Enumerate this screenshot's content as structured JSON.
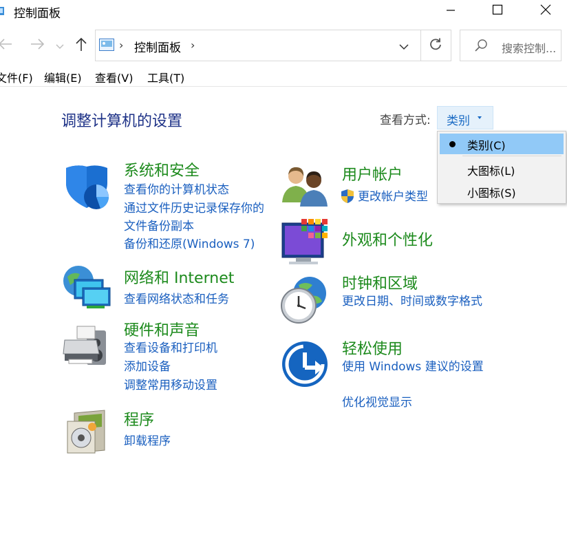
{
  "window": {
    "title": "控制面板",
    "icons": {
      "app": "control-panel-icon",
      "minimize": "minimize-icon",
      "maximize": "maximize-icon",
      "close": "close-icon"
    }
  },
  "nav": {
    "back": "back-arrow-icon",
    "forward": "forward-arrow-icon",
    "recent": "chevron-down-icon",
    "up": "up-arrow-icon"
  },
  "address": {
    "crumb": "控制面板",
    "refresh_icon": "refresh-icon"
  },
  "search": {
    "placeholder": "搜索控制..."
  },
  "menu": [
    "文件(F)",
    "编辑(E)",
    "查看(V)",
    "工具(T)"
  ],
  "main": {
    "heading": "调整计算机的设置",
    "view_label": "查看方式:",
    "view_value": "类别"
  },
  "view_menu": {
    "items": [
      {
        "label": "类别(C)",
        "selected": true
      },
      {
        "label": "大图标(L)",
        "selected": false
      },
      {
        "label": "小图标(S)",
        "selected": false
      }
    ]
  },
  "categories": {
    "system": {
      "title": "系统和安全",
      "icon": "shield-pie-icon",
      "links": [
        "查看你的计算机状态",
        "通过文件历史记录保存你的文件备份副本",
        "备份和还原(Windows 7)"
      ]
    },
    "network": {
      "title": "网络和 Internet",
      "icon": "globe-network-icon",
      "links": [
        "查看网络状态和任务"
      ]
    },
    "hardware": {
      "title": "硬件和声音",
      "icon": "printer-speaker-icon",
      "links": [
        "查看设备和打印机",
        "添加设备",
        "调整常用移动设置"
      ]
    },
    "programs": {
      "title": "程序",
      "icon": "programs-disc-icon",
      "links": [
        "卸载程序"
      ]
    },
    "users": {
      "title": "用户帐户",
      "icon": "users-icon",
      "links": [
        "更改帐户类型"
      ]
    },
    "appearance": {
      "title": "外观和个性化",
      "icon": "monitor-tiles-icon",
      "links": []
    },
    "clock": {
      "title": "时钟和区域",
      "icon": "clock-globe-icon",
      "links": [
        "更改日期、时间或数字格式"
      ]
    },
    "ease": {
      "title": "轻松使用",
      "icon": "ease-of-access-icon",
      "links": [
        "使用 Windows 建议的设置",
        "优化视觉显示"
      ]
    }
  },
  "colors": {
    "category_title": "#1c8a1c",
    "link": "#1a5fbf",
    "heading": "#1e3287",
    "selected_item": "#91c9f7"
  }
}
